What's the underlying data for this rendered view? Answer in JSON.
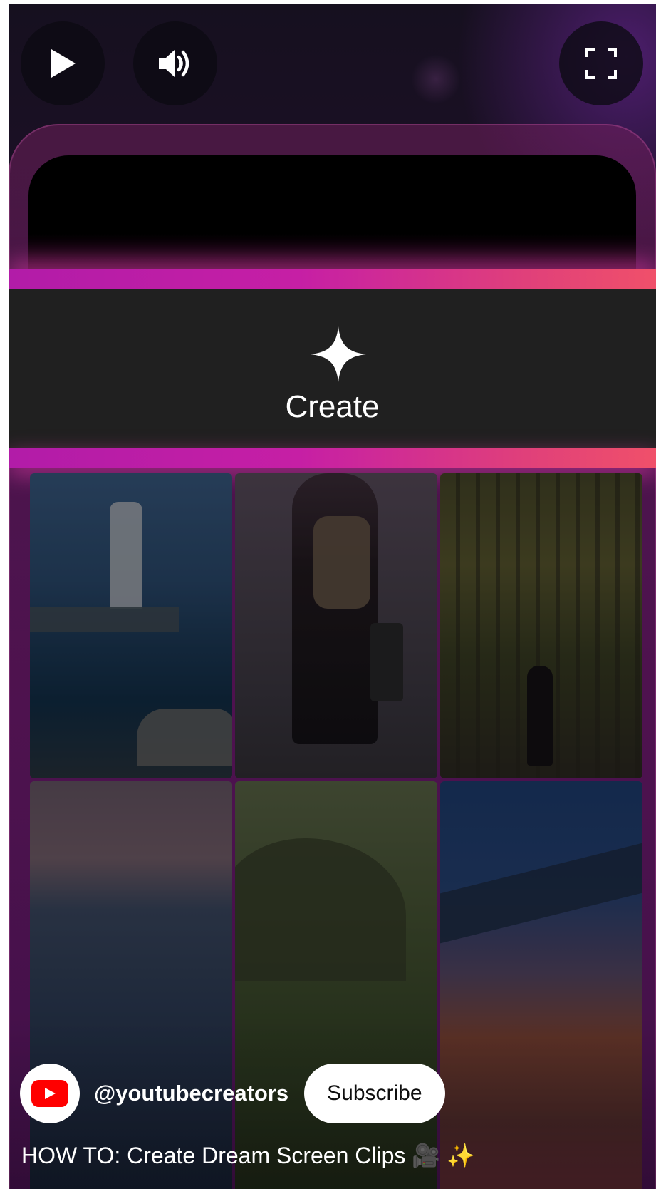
{
  "player": {
    "controls": {
      "play_icon": "play-icon",
      "volume_icon": "volume-icon",
      "fullscreen_icon": "fullscreen-icon"
    }
  },
  "banner": {
    "icon": "sparkle-icon",
    "label": "Create"
  },
  "channel": {
    "handle": "@youtubecreators",
    "avatar_icon": "youtube-logo-icon",
    "subscribe_label": "Subscribe"
  },
  "video": {
    "title": "HOW TO: Create Dream Screen Clips 🎥 ✨"
  },
  "colors": {
    "accent_gradient_start": "#b21ca8",
    "accent_gradient_end": "#f0506a",
    "youtube_red": "#ff0000",
    "band_background": "#202020"
  }
}
